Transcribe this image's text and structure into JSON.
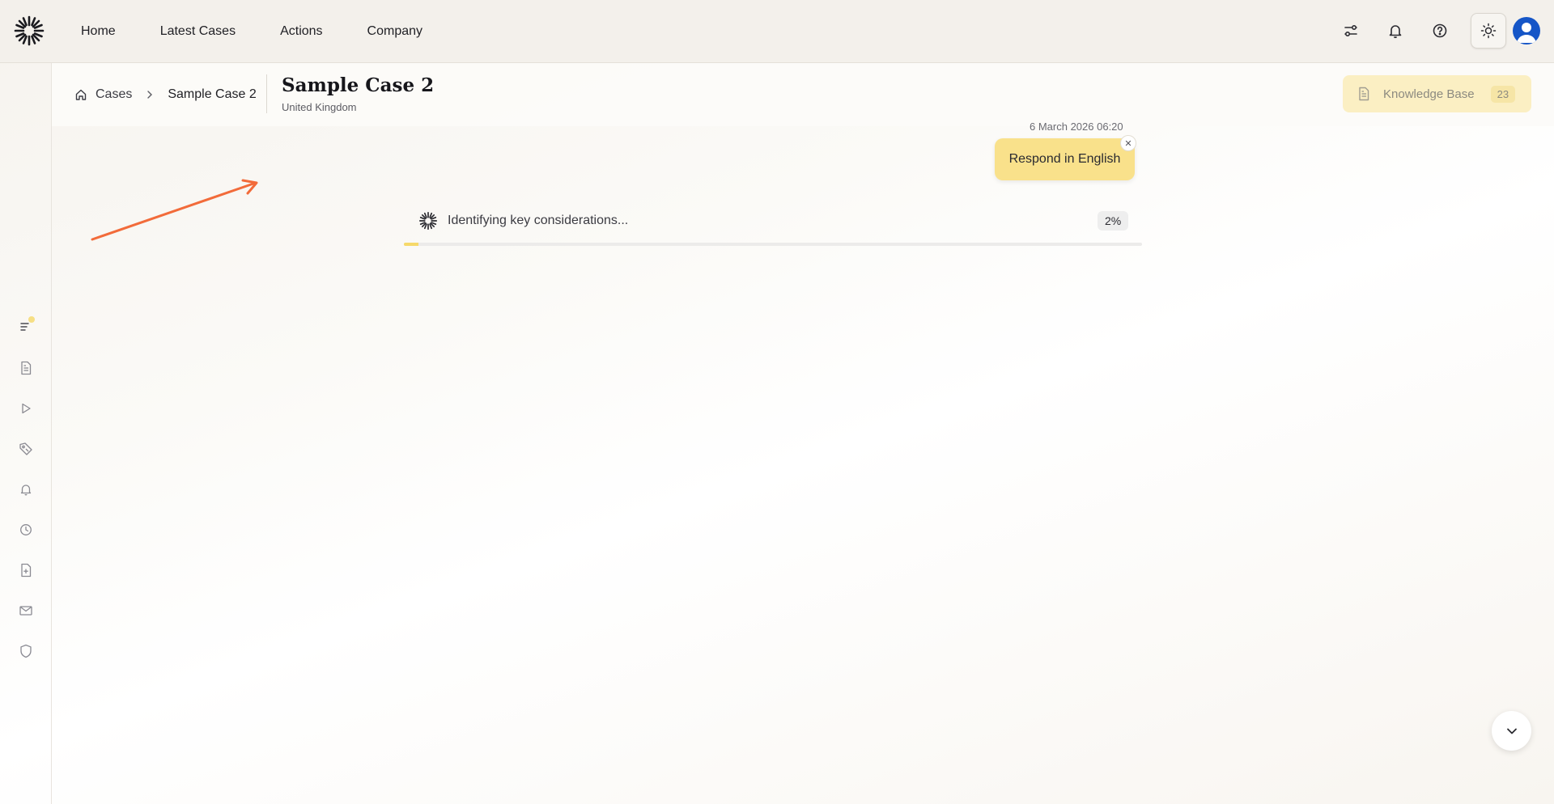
{
  "topbar": {
    "nav": [
      "Home",
      "Latest Cases",
      "Actions",
      "Company"
    ],
    "icons": [
      "filters-icon",
      "bell-icon",
      "help-icon",
      "sun-icon",
      "avatar"
    ]
  },
  "sidebar": {
    "icons": [
      "list-icon",
      "document-icon",
      "play-icon",
      "tag-icon",
      "bell-icon",
      "clock-icon",
      "file-plus-icon",
      "mail-icon",
      "shield-icon"
    ]
  },
  "header": {
    "breadcrumb": {
      "root": "Cases",
      "current": "Sample Case 2"
    },
    "title": "Sample Case 2",
    "subtitle": "United Kingdom",
    "knowledge_base": {
      "label": "Knowledge Base",
      "count": "23"
    }
  },
  "chat": {
    "timestamp": "6 March 2026 06:20",
    "chip_label": "Respond in English",
    "progress": {
      "label": "Identifying key considerations...",
      "percent_text": "2%",
      "percent": 2
    }
  },
  "colors": {
    "accent_yellow": "#f9e18b",
    "arrow": "#f26b3a",
    "avatar": "#1656c7"
  }
}
